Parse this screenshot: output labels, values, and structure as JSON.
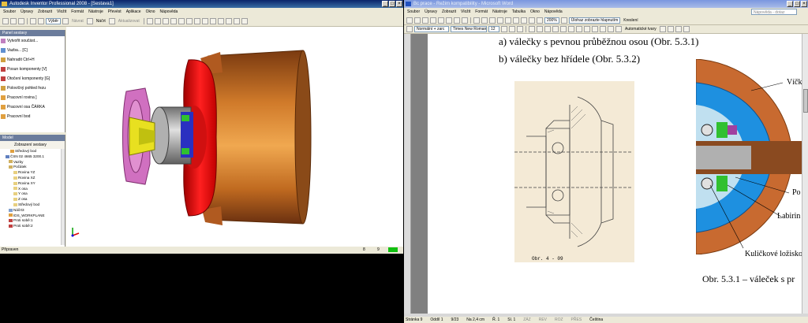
{
  "inventor": {
    "title": "Autodesk Inventor Professional 2008 - [Sestava1]",
    "menu": [
      "Soubor",
      "Úpravy",
      "Zobrazit",
      "Vložit",
      "Formát",
      "Nástroje",
      "Převést",
      "Aplikace",
      "Okno",
      "Nápověda"
    ],
    "toolbar": {
      "style_label": "Výběr",
      "sketch_label": "Náčrt",
      "return_label": "Návrat",
      "update_label": "Aktualizovat"
    },
    "panel": {
      "header": "Panel sestavy",
      "items": [
        "Vytvořit součást...",
        "Vazba...  [C]",
        "Nahradit  Ctrl+H",
        "Posun komponenty  [V]",
        "Otočení komponenty  [G]",
        "Polovičný pohled řezu",
        "Pracovní rovina  ]",
        "Pracovní osa  ČÁRKA",
        "Pracovní bod"
      ]
    },
    "model": {
      "header": "Model",
      "view_label": "Zobrazení sestavy",
      "tree": [
        "Středový bod",
        "ČSN 02 4665 3200.1",
        "Vazby",
        "Počátek",
        "Rovina YZ",
        "Rovina XZ",
        "Rovina XY",
        "X osa",
        "Y osa",
        "Z osa",
        "Středový bod",
        "Náčrt3",
        "IDS_WORKPLANE",
        "Proti sobě:1",
        "Proti sobě:2"
      ]
    },
    "status": {
      "left": "Připraven",
      "n1": "8",
      "n2": "9"
    }
  },
  "word": {
    "title": "Bc prace - Režim kompatibility - Microsoft Word",
    "menu": [
      "Soubor",
      "Úpravy",
      "Zobrazit",
      "Vložit",
      "Formát",
      "Nástroje",
      "Tabulka",
      "Okno",
      "Nápověda"
    ],
    "search_placeholder": "Nápověda - dotaz",
    "zoom": "200%",
    "markup_label": "Úlohaz zobrazte hlapnutím",
    "style": "Normální + zarc",
    "font": "Times New Roman",
    "size": "12",
    "reply_label": "Kreslení",
    "autoshapes_label": "Automatické tvary",
    "doc": {
      "line_a": "a)   válečky s pevnou průběžnou osou (Obr. 5.3.1)",
      "line_b": "b)   válečky bez hřídele (Obr. 5.3.2)",
      "drawing_caption": "Obr. 4 - 09",
      "label_vicko": "Víčko",
      "label_po": "Po",
      "label_labirin": "Labirin",
      "label_lozisko": "Kuličkové ložisko",
      "figure_caption": "Obr. 5.3.1 – váleček s pr"
    },
    "status": [
      "Stránka 9",
      "Oddíl 1",
      "9/23",
      "Na 2,4 cm",
      "Ř. 1",
      "Sl. 1",
      "ZÁZ",
      "REV",
      "ROZ",
      "PŘES",
      "Čeština"
    ]
  }
}
